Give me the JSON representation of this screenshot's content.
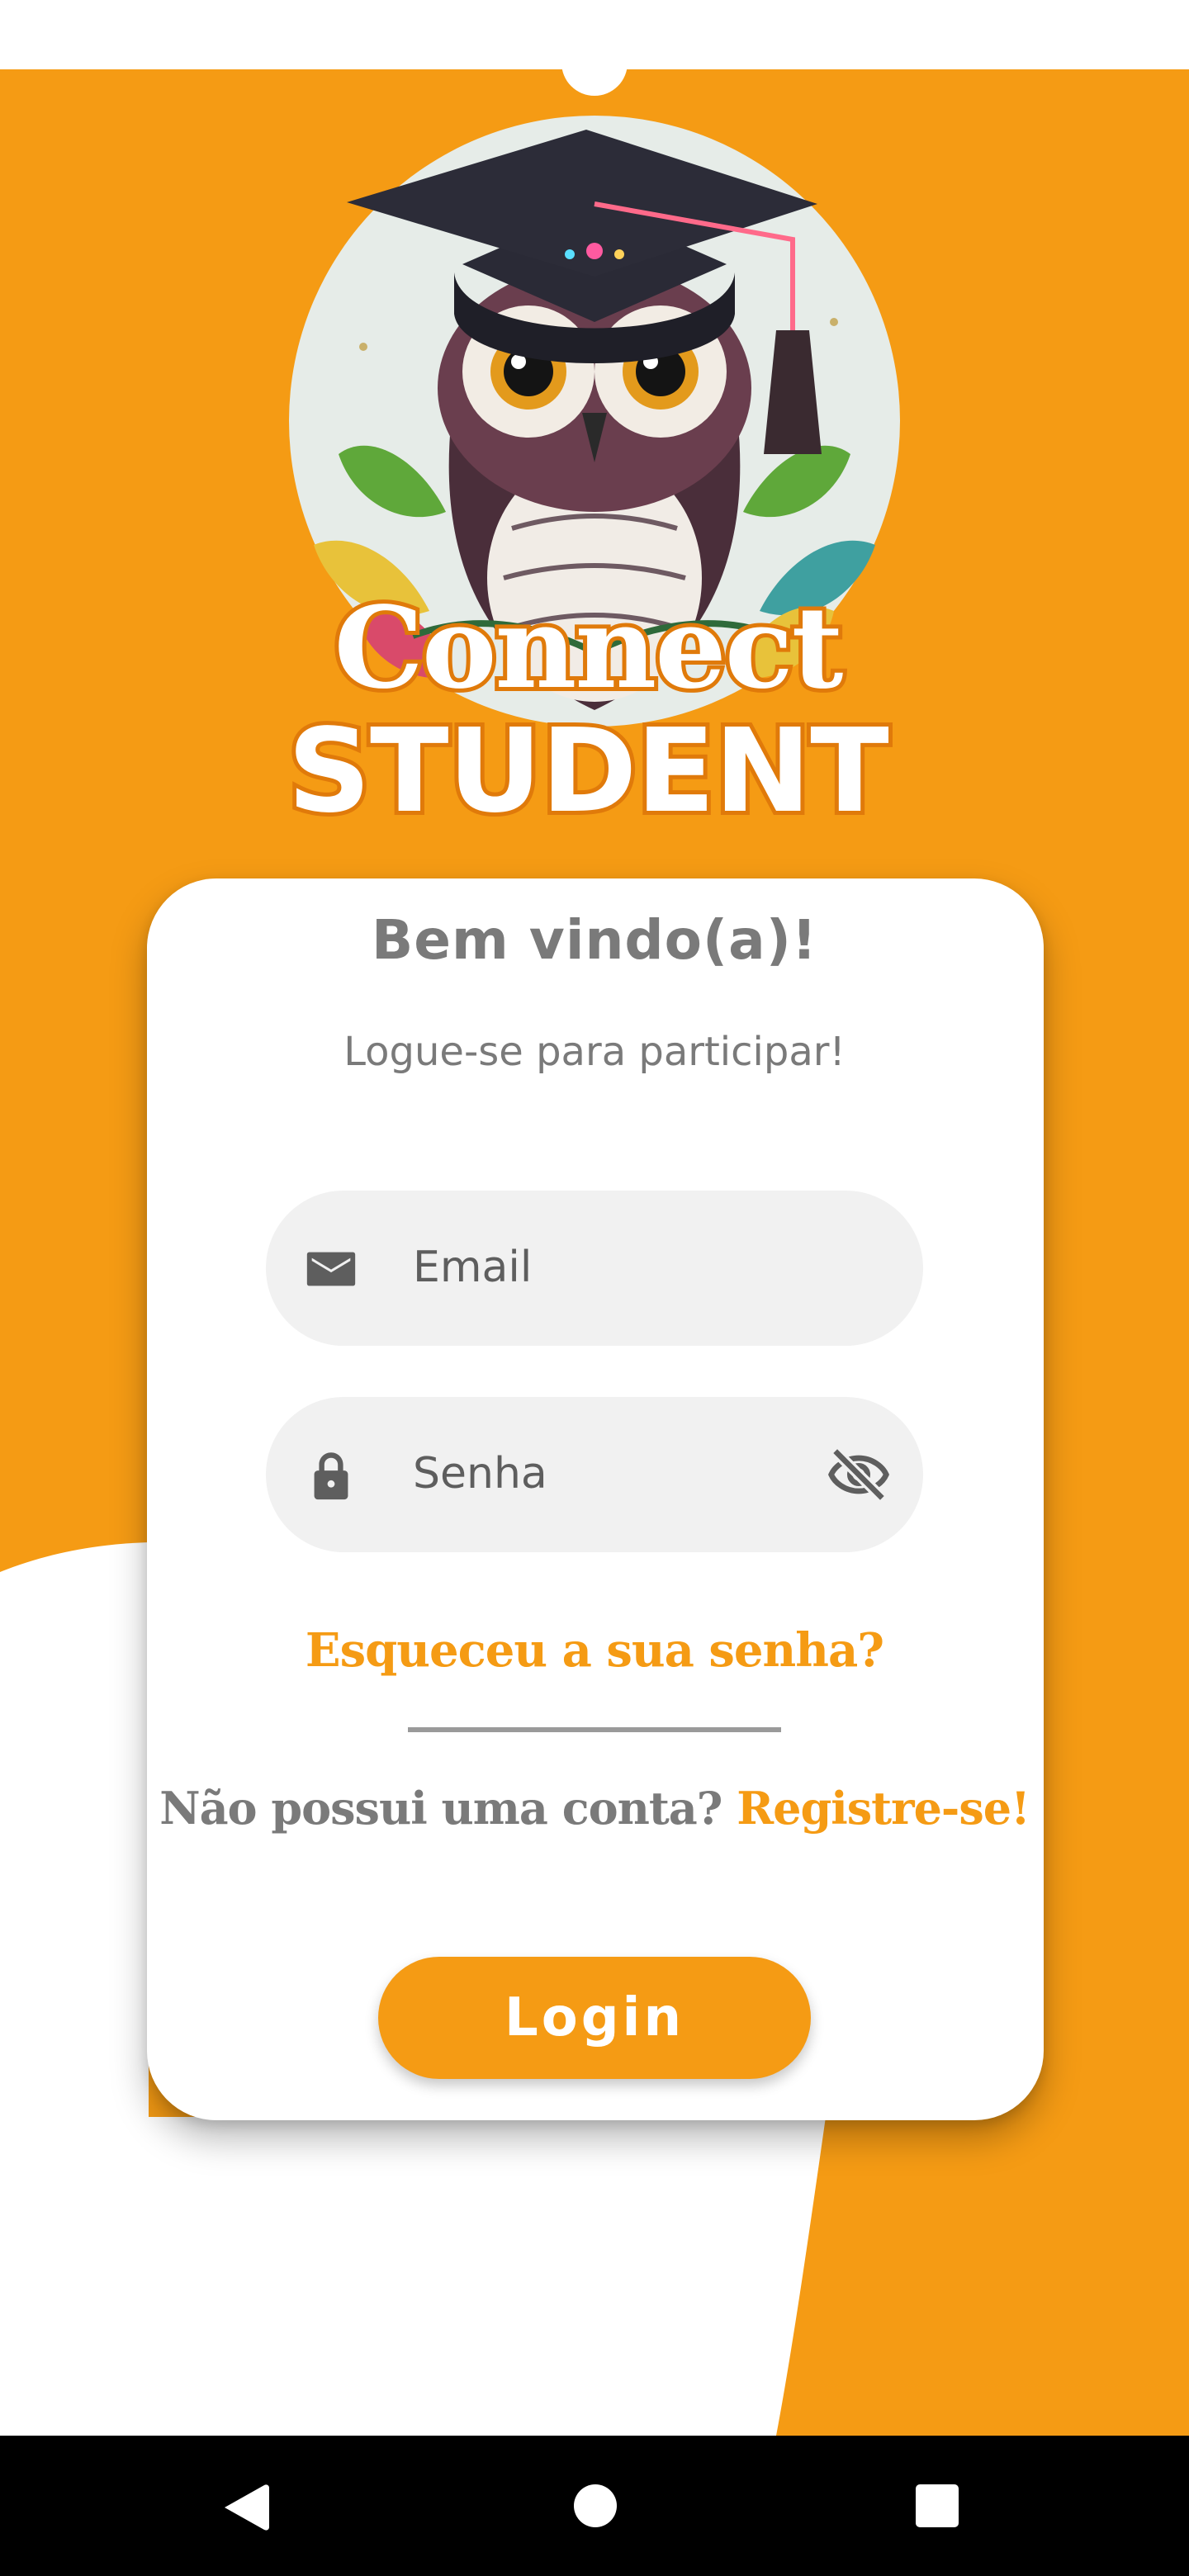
{
  "app": {
    "name_line1": "Connect",
    "name_line2": "STUDENT",
    "accent_color": "#F59B14"
  },
  "login_card": {
    "title": "Bem vindo(a)!",
    "subtitle": "Logue-se para participar!"
  },
  "email_field": {
    "placeholder": "Email",
    "icon": "envelope-icon"
  },
  "password_field": {
    "placeholder": "Senha",
    "icon": "lock-icon",
    "toggle_icon": "eye-off-icon"
  },
  "links": {
    "forgot_password": "Esqueceu a sua senha?",
    "no_account_prompt": "Não possui uma conta?",
    "register": "Registre-se!"
  },
  "login_button": {
    "label": "Login"
  },
  "navigation_bar": {
    "buttons": [
      "back-icon",
      "home-icon",
      "recents-icon"
    ]
  }
}
